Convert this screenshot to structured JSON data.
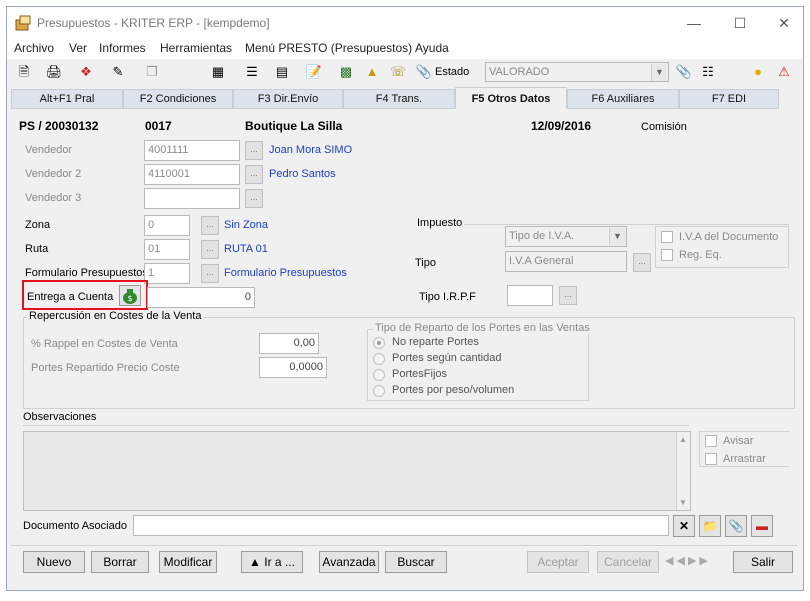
{
  "window": {
    "title": "Presupuestos - KRITER ERP - [kempdemo]"
  },
  "menu": [
    "Archivo",
    "Ver",
    "Informes",
    "Herramientas",
    "Menú PRESTO (Presupuestos)",
    "Ayuda"
  ],
  "toolbar": {
    "estado_label": "Estado",
    "estado_value": "VALORADO"
  },
  "tabs": [
    "Alt+F1 Pral",
    "F2 Condiciones",
    "F3 Dir.Envío",
    "F4 Trans.",
    "F5 Otros Datos",
    "F6 Auxiliares",
    "F7 EDI"
  ],
  "header": {
    "doc": "PS / 20030132",
    "code": "0017",
    "client": "Boutique La Silla",
    "date": "12/09/2016",
    "comision": "Comisión"
  },
  "fields": {
    "vendedor_label": "Vendedor",
    "vendedor_value": "4001111",
    "vendedor_name": "Joan Mora SIMO",
    "vendedor2_label": "Vendedor 2",
    "vendedor2_value": "4110001",
    "vendedor2_name": "Pedro Santos",
    "vendedor3_label": "Vendedor 3",
    "vendedor3_value": "",
    "zona_label": "Zona",
    "zona_value": "0",
    "zona_name": "Sin Zona",
    "ruta_label": "Ruta",
    "ruta_value": "01",
    "ruta_name": "RUTA 01",
    "formulario_label": "Formulario Presupuestos",
    "formulario_value": "1",
    "formulario_name": "Formulario Presupuestos",
    "entrega_label": "Entrega a Cuenta",
    "entrega_value": "0"
  },
  "impuesto": {
    "title": "Impuesto",
    "tipo_iva": "Tipo de I.V.A.",
    "tipo_label": "Tipo",
    "tipo_value": "I.V.A General",
    "iva_documento": "I.V.A del Documento",
    "reg_eq": "Reg. Eq.",
    "irpf_label": "Tipo I.R.P.F",
    "irpf_value": ""
  },
  "repercusion": {
    "title": "Repercusión en Costes de la Venta",
    "rappel_label": "% Rappel en Costes de Venta",
    "rappel_value": "0,00",
    "portes_label": "Portes Repartido Precio Coste",
    "portes_value": "0,0000"
  },
  "reparto": {
    "title": "Tipo de Reparto de los Portes en las Ventas",
    "options": [
      "No reparte Portes",
      "Portes según cantidad",
      "PortesFijos",
      "Portes por peso/volumen"
    ]
  },
  "observaciones": {
    "label": "Observaciones",
    "avisar": "Avisar",
    "arrastrar": "Arrastrar"
  },
  "documento": {
    "label": "Documento Asociado",
    "value": ""
  },
  "buttons": {
    "nuevo": "Nuevo",
    "borrar": "Borrar",
    "modificar": "Modificar",
    "ira": "▲ Ir a ...",
    "avanzada": "Avanzada",
    "buscar": "Buscar",
    "aceptar": "Aceptar",
    "cancelar": "Cancelar",
    "salir": "Salir"
  }
}
